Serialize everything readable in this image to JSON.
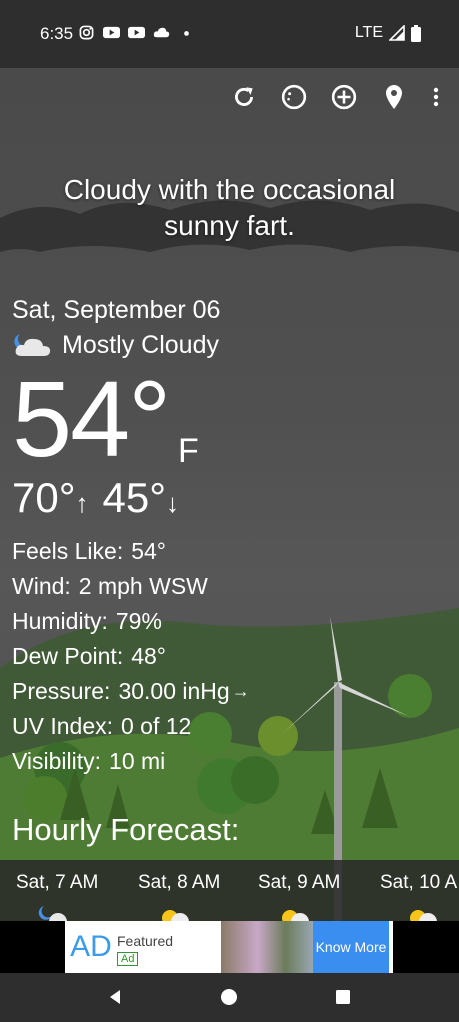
{
  "status_bar": {
    "time": "6:35",
    "notification_icons": [
      "instagram-icon",
      "youtube-icon",
      "youtube-icon",
      "cloud-icon",
      "dot-icon"
    ],
    "network": "LTE"
  },
  "toolbar": {
    "icons": [
      "refresh-icon",
      "theme-icon",
      "add-location-icon",
      "location-pin-icon",
      "more-vert-icon"
    ]
  },
  "tagline": {
    "line1": "Cloudy with the occasional",
    "line2": "sunny fart."
  },
  "current": {
    "date": "Sat, September 06",
    "condition": "Mostly Cloudy",
    "temp": "54°",
    "unit": "F",
    "high": "70°",
    "high_arrow": "↑",
    "low": "45°",
    "low_arrow": "↓"
  },
  "details": [
    {
      "label": "Feels Like:",
      "value": "54°"
    },
    {
      "label": "Wind:",
      "value": "2 mph WSW"
    },
    {
      "label": "Humidity:",
      "value": "79%"
    },
    {
      "label": "Dew Point:",
      "value": "48°"
    },
    {
      "label": "Pressure:",
      "value": "30.00 inHg",
      "suffix": "→"
    },
    {
      "label": "UV Index:",
      "value": "0 of 12"
    },
    {
      "label": "Visibility:",
      "value": "10 mi"
    }
  ],
  "hourly": {
    "title": "Hourly Forecast:",
    "items": [
      {
        "label": "Sat, 7 AM",
        "icon": "moon-cloud-icon"
      },
      {
        "label": "Sat, 8 AM",
        "icon": "sun-cloud-icon"
      },
      {
        "label": "Sat, 9 AM",
        "icon": "sun-cloud-icon"
      },
      {
        "label": "Sat, 10 A",
        "icon": "sun-cloud-icon"
      }
    ]
  },
  "ad": {
    "logo_text": "AD",
    "title": "Featured",
    "tag": "Ad",
    "cta": "Know More"
  },
  "nav": {
    "icons": [
      "back-icon",
      "home-icon",
      "recents-icon"
    ]
  },
  "colors": {
    "ad_blue": "#3a8ef0",
    "ad_green": "#2a9a2a"
  }
}
